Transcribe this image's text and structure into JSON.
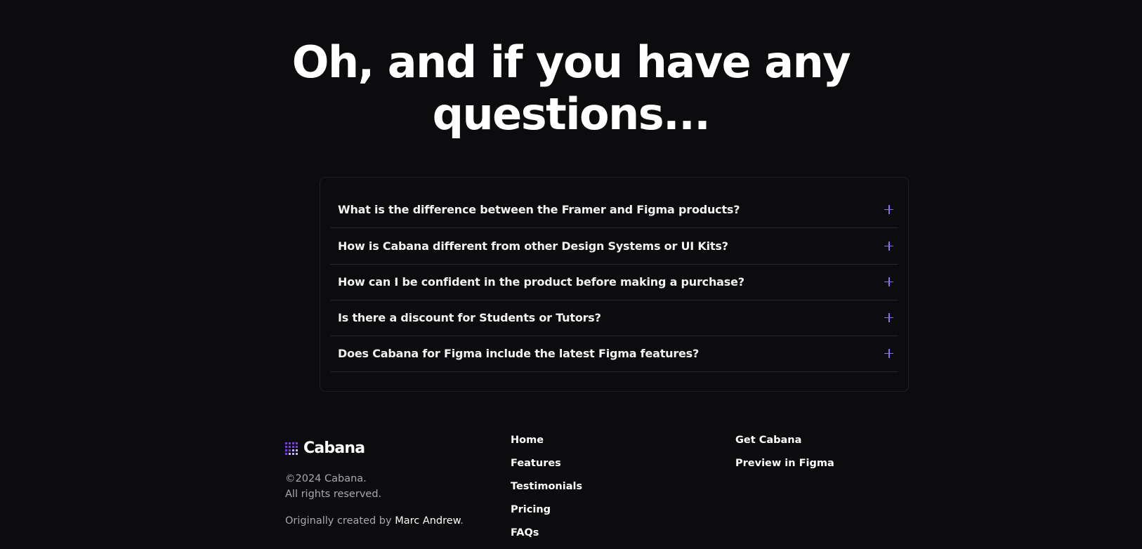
{
  "heading": {
    "line1": "Oh, and if you have any",
    "line2": "questions..."
  },
  "faq": {
    "accent": "#8b6cf0",
    "items": [
      {
        "question": "What is the difference between the Framer and Figma products?",
        "icon": "plus-icon"
      },
      {
        "question": "How is Cabana different from other Design Systems or UI Kits?",
        "icon": "plus-icon"
      },
      {
        "question": "How can I be confident in the product before making a purchase?",
        "icon": "plus-icon"
      },
      {
        "question": "Is there a discount for Students or Tutors?",
        "icon": "plus-icon"
      },
      {
        "question": "Does Cabana for Figma include the latest Figma features?",
        "icon": "plus-icon"
      }
    ]
  },
  "footer": {
    "brand": "Cabana",
    "copyright": "©2024 Cabana.",
    "rights": "All rights reserved.",
    "credit_prefix": "Originally created by ",
    "credit_name": "Marc Andrew",
    "credit_suffix": ".",
    "nav": [
      "Home",
      "Features",
      "Testimonials",
      "Pricing",
      "FAQs"
    ],
    "actions": [
      "Get Cabana",
      "Preview in Figma"
    ]
  }
}
